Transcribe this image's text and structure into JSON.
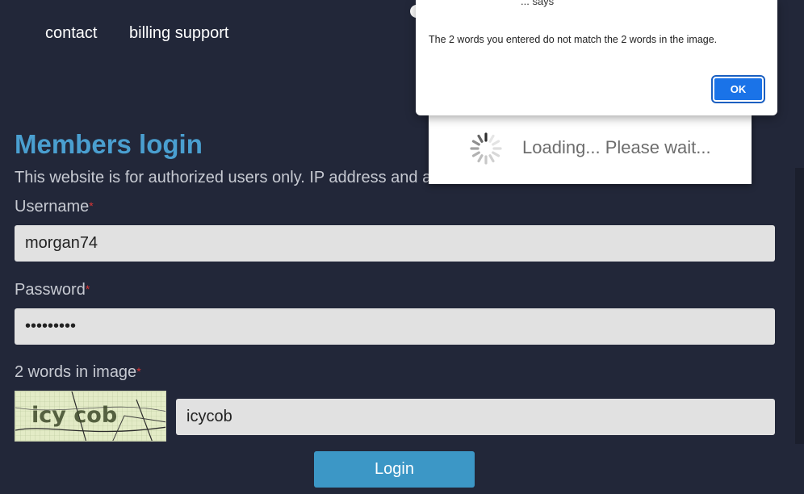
{
  "nav": {
    "contact": "contact",
    "billing_support": "billing support"
  },
  "login": {
    "title": "Members login",
    "notice": "This website is for authorized users only. IP address and a",
    "username_label": "Username",
    "username_value": "morgan74",
    "password_label": "Password",
    "password_value": "•••••••••",
    "captcha_label": "2 words in image",
    "captcha_image_text": "icy cob",
    "captcha_value": "icycob",
    "required_mark": "*",
    "login_button": "Login"
  },
  "loading": {
    "text": "Loading... Please wait..."
  },
  "alert": {
    "header": "... says",
    "message": "The 2 words you entered do not match the 2 words in the image.",
    "ok_label": "OK"
  },
  "colors": {
    "background": "#222739",
    "title": "#4a9fd0",
    "button": "#3c97c6",
    "required": "#d93535",
    "ok_button": "#1a73e8"
  }
}
